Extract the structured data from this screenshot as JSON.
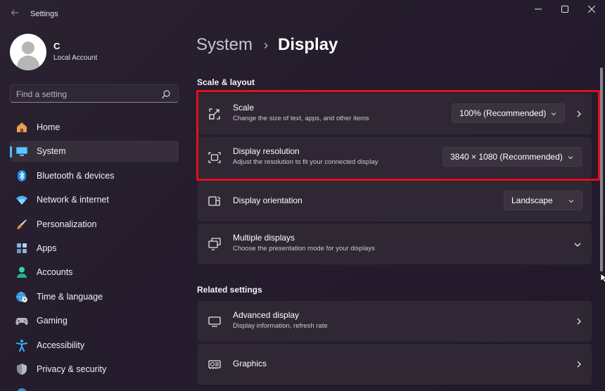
{
  "app": {
    "title": "Settings"
  },
  "profile": {
    "name": "C",
    "account_type": "Local Account"
  },
  "search": {
    "placeholder": "Find a setting"
  },
  "nav": [
    {
      "label": "Home",
      "icon": "home-icon",
      "active": false
    },
    {
      "label": "System",
      "icon": "system-icon",
      "active": true
    },
    {
      "label": "Bluetooth & devices",
      "icon": "bluetooth-icon",
      "active": false
    },
    {
      "label": "Network & internet",
      "icon": "wifi-icon",
      "active": false
    },
    {
      "label": "Personalization",
      "icon": "brush-icon",
      "active": false
    },
    {
      "label": "Apps",
      "icon": "apps-icon",
      "active": false
    },
    {
      "label": "Accounts",
      "icon": "accounts-icon",
      "active": false
    },
    {
      "label": "Time & language",
      "icon": "globe-clock-icon",
      "active": false
    },
    {
      "label": "Gaming",
      "icon": "gamepad-icon",
      "active": false
    },
    {
      "label": "Accessibility",
      "icon": "accessibility-icon",
      "active": false
    },
    {
      "label": "Privacy & security",
      "icon": "shield-icon",
      "active": false
    }
  ],
  "breadcrumb": {
    "parent": "System",
    "separator": "›",
    "current": "Display"
  },
  "sections": {
    "scale_layout": "Scale & layout",
    "related": "Related settings"
  },
  "cards": {
    "scale": {
      "title": "Scale",
      "description": "Change the size of text, apps, and other items",
      "value": "100% (Recommended)"
    },
    "resolution": {
      "title": "Display resolution",
      "description": "Adjust the resolution to fit your connected display",
      "value": "3840 × 1080 (Recommended)"
    },
    "orientation": {
      "title": "Display orientation",
      "value": "Landscape"
    },
    "multiple": {
      "title": "Multiple displays",
      "description": "Choose the presentation mode for your displays"
    },
    "advanced": {
      "title": "Advanced display",
      "description": "Display information, refresh rate"
    },
    "graphics": {
      "title": "Graphics"
    }
  },
  "colors": {
    "accent": "#4cc2ff",
    "highlight": "#e3101c",
    "card": "#2f2834"
  }
}
